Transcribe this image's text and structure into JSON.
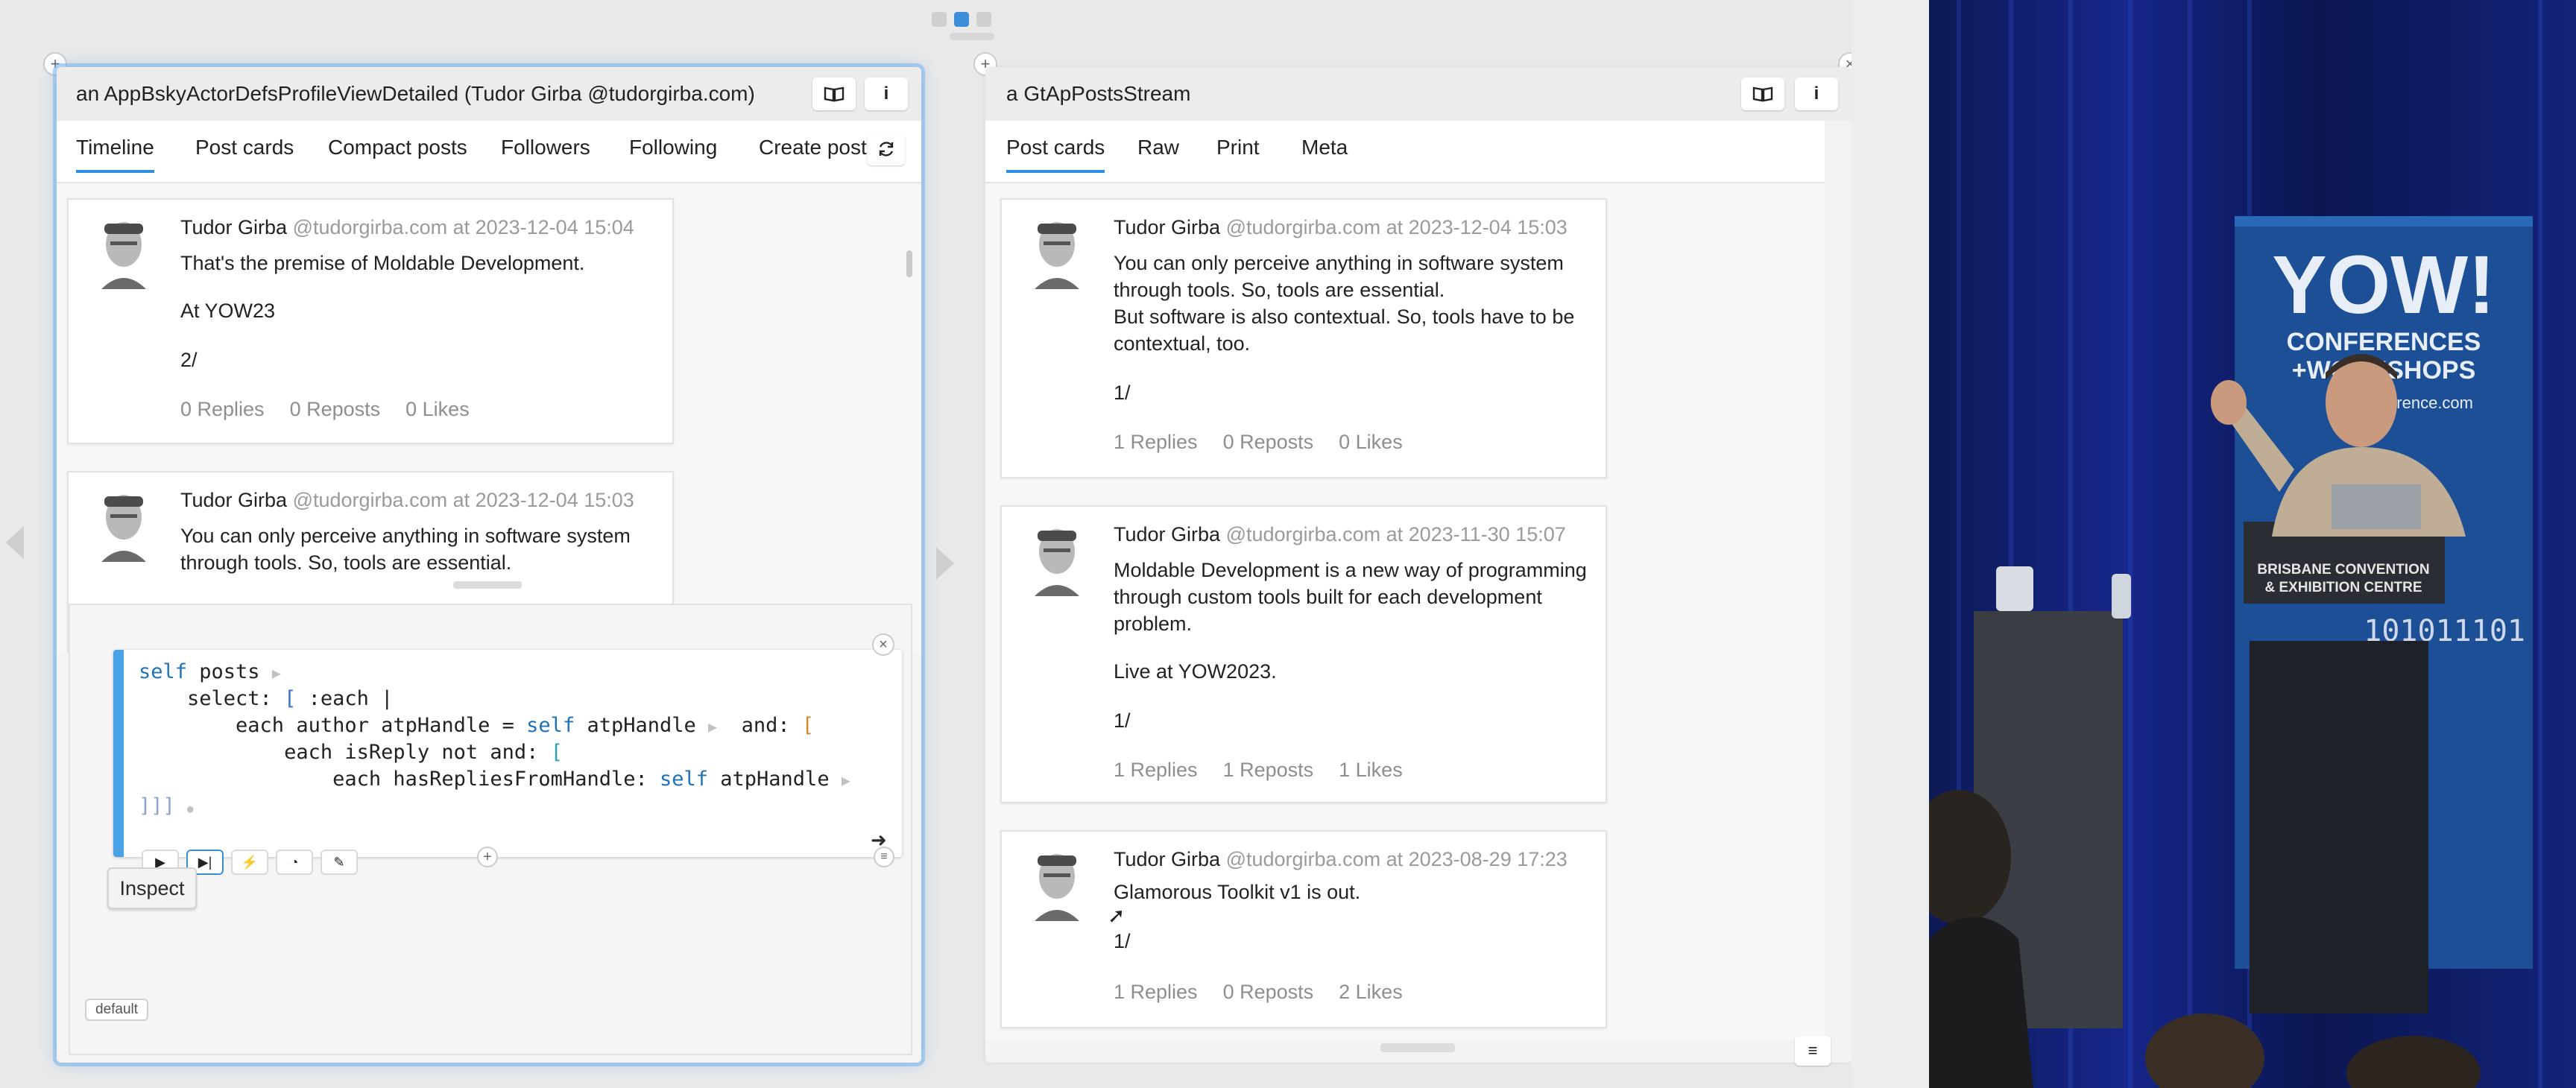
{
  "pager": {
    "dots": 3,
    "active": 1
  },
  "pane_left": {
    "title": "an AppBskyActorDefsProfileViewDetailed (Tudor Girba @tudorgirba.com)",
    "book_icon": "book-icon",
    "info_label": "i",
    "tabs": [
      {
        "label": "Timeline",
        "selected": true
      },
      {
        "label": "Post cards"
      },
      {
        "label": "Compact posts"
      },
      {
        "label": "Followers"
      },
      {
        "label": "Following"
      },
      {
        "label": "Create post"
      }
    ],
    "posts": [
      {
        "author": "Tudor Girba",
        "meta": "@tudorgirba.com at 2023-12-04 15:04",
        "lines": [
          "That's the premise of Moldable Development.",
          "At YOW23",
          "2/"
        ],
        "replies": "0 Replies",
        "reposts": "0 Reposts",
        "likes": "0 Likes"
      },
      {
        "author": "Tudor Girba",
        "meta": "@tudorgirba.com at 2023-12-04 15:03",
        "lines": [
          "You can only perceive anything in software system",
          "through tools. So, tools are essential."
        ]
      }
    ],
    "playground": {
      "code": {
        "l1a": "self",
        "l1b": " posts",
        "l2a": "    select: ",
        "l2b": "[",
        "l2c": " :each |",
        "l3a": "        each author atpHandle = ",
        "l3b": "self",
        "l3c": " atpHandle",
        "l3d": "  and: ",
        "l3e": "[",
        "l4a": "            each isReply not and: ",
        "l4b": "[",
        "l5a": "                each hasRepliesFromHandle: ",
        "l5b": "self",
        "l5c": " atpHandle",
        "l6": "]]]"
      },
      "tooltip": "Inspect",
      "badge": "default"
    }
  },
  "pane_right": {
    "title": "a GtApPostsStream",
    "info_label": "i",
    "tabs": [
      {
        "label": "Post cards",
        "selected": true
      },
      {
        "label": "Raw"
      },
      {
        "label": "Print"
      },
      {
        "label": "Meta"
      }
    ],
    "posts": [
      {
        "author": "Tudor Girba",
        "meta": "@tudorgirba.com at 2023-12-04 15:03",
        "lines": [
          "You can only perceive anything in software system",
          "through tools. So, tools are essential.",
          "But software is also contextual. So, tools have to be",
          "contextual, too.",
          "1/"
        ],
        "replies": "1 Replies",
        "reposts": "0 Reposts",
        "likes": "0 Likes"
      },
      {
        "author": "Tudor Girba",
        "meta": "@tudorgirba.com at 2023-11-30 15:07",
        "lines": [
          "Moldable Development is a new way of programming",
          "through custom tools built for each development",
          "problem.",
          "Live at YOW2023.",
          "1/"
        ],
        "replies": "1 Replies",
        "reposts": "1 Reposts",
        "likes": "1 Likes"
      },
      {
        "author": "Tudor Girba",
        "meta": "@tudorgirba.com at 2023-08-29 17:23",
        "lines": [
          "Glamorous Toolkit v1 is out.",
          "1/"
        ],
        "replies": "1 Replies",
        "reposts": "0 Reposts",
        "likes": "2 Likes"
      }
    ]
  },
  "photo": {
    "banner_title": "YOW!",
    "banner_sub1": "CONFERENCES",
    "banner_sub2": "+WORKSHOPS",
    "banner_url": "conference.com",
    "podium_l1": "BRISBANE CONVENTION",
    "podium_l2": "& EXHIBITION CENTRE",
    "binary": "101011101"
  }
}
